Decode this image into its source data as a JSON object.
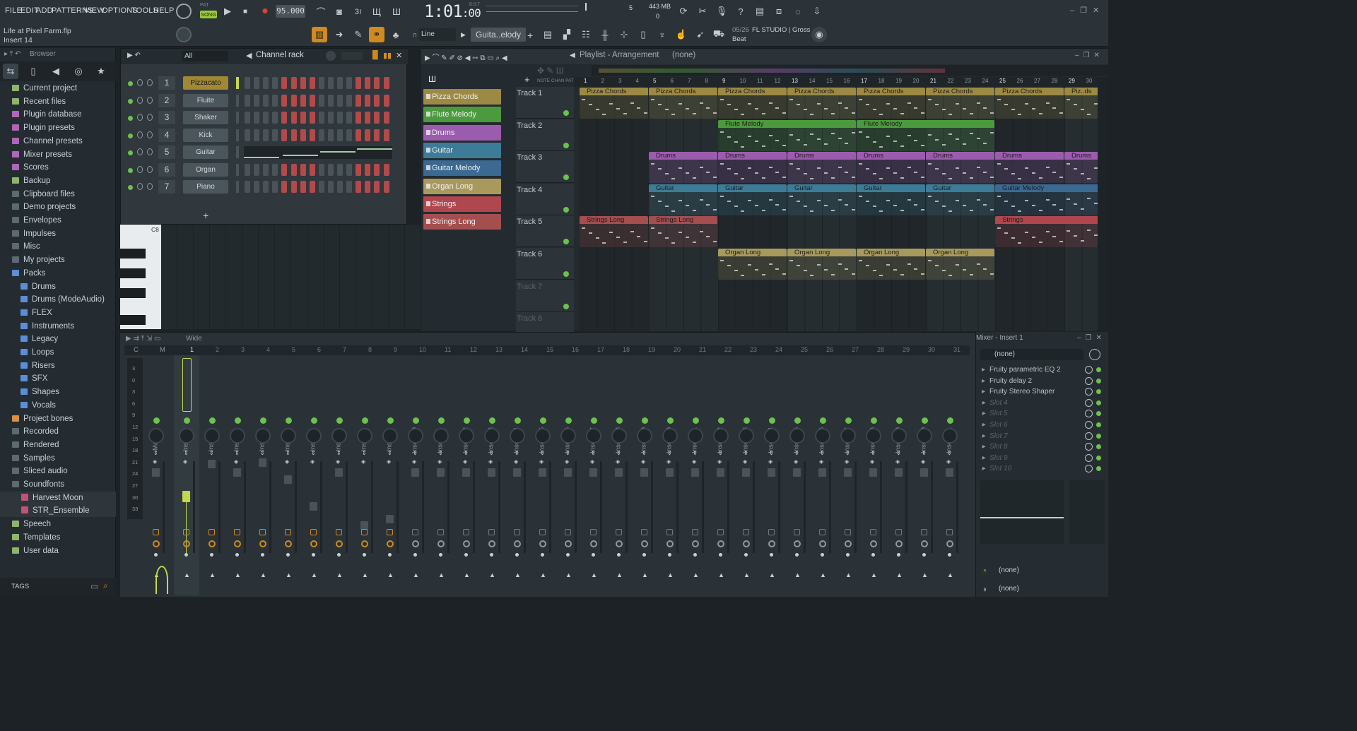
{
  "menubar": {
    "items": [
      "FILE",
      "EDIT",
      "ADD",
      "PATTERNS",
      "VIEW",
      "OPTIONS",
      "TOOLS",
      "HELP"
    ],
    "pat_label": "PAT",
    "song_label": "SONG",
    "tempo": "95.000",
    "time": "1:01",
    "time_ticks": ":00",
    "bst_label": "B:S:T",
    "cpu_value": "5",
    "memory": "443 MB",
    "poly": "0",
    "snap_mode": "Line",
    "pattern_name": "Guita..elody",
    "news_counter": "05/26",
    "news_text": "FL STUDIO | Gross",
    "news_text2": "Beat",
    "project_file": "Life at Pixel Farm.flp",
    "hint_text": "Insert 14"
  },
  "browser": {
    "title": "Browser",
    "tags_label": "TAGS",
    "items": [
      {
        "label": "Current project",
        "color": "#8fb56a"
      },
      {
        "label": "Recent files",
        "color": "#8fb56a"
      },
      {
        "label": "Plugin database",
        "color": "#b066b8"
      },
      {
        "label": "Plugin presets",
        "color": "#b066b8"
      },
      {
        "label": "Channel presets",
        "color": "#b066b8"
      },
      {
        "label": "Mixer presets",
        "color": "#b066b8"
      },
      {
        "label": "Scores",
        "color": "#b066b8"
      },
      {
        "label": "Backup",
        "color": "#8fb56a"
      },
      {
        "label": "Clipboard files",
        "color": "#5c6a72"
      },
      {
        "label": "Demo projects",
        "color": "#5c6a72"
      },
      {
        "label": "Envelopes",
        "color": "#5c6a72"
      },
      {
        "label": "Impulses",
        "color": "#5c6a72"
      },
      {
        "label": "Misc",
        "color": "#5c6a72"
      },
      {
        "label": "My projects",
        "color": "#5c6a72"
      },
      {
        "label": "Packs",
        "color": "#5a8fd8"
      },
      {
        "label": "Drums",
        "color": "#5a8fd8",
        "sub": true
      },
      {
        "label": "Drums (ModeAudio)",
        "color": "#5a8fd8",
        "sub": true
      },
      {
        "label": "FLEX",
        "color": "#5a8fd8",
        "sub": true
      },
      {
        "label": "Instruments",
        "color": "#5a8fd8",
        "sub": true
      },
      {
        "label": "Legacy",
        "color": "#5a8fd8",
        "sub": true
      },
      {
        "label": "Loops",
        "color": "#5a8fd8",
        "sub": true
      },
      {
        "label": "Risers",
        "color": "#5a8fd8",
        "sub": true
      },
      {
        "label": "SFX",
        "color": "#5a8fd8",
        "sub": true
      },
      {
        "label": "Shapes",
        "color": "#5a8fd8",
        "sub": true
      },
      {
        "label": "Vocals",
        "color": "#5a8fd8",
        "sub": true
      },
      {
        "label": "Project bones",
        "color": "#d89046"
      },
      {
        "label": "Recorded",
        "color": "#5c6a72"
      },
      {
        "label": "Rendered",
        "color": "#5c6a72"
      },
      {
        "label": "Samples",
        "color": "#5c6a72"
      },
      {
        "label": "Sliced audio",
        "color": "#5c6a72"
      },
      {
        "label": "Soundfonts",
        "color": "#5c6a72"
      },
      {
        "label": "Harvest Moon",
        "color": "#c2517a",
        "sub2": true
      },
      {
        "label": "STR_Ensemble",
        "color": "#c2517a",
        "sub2": true
      },
      {
        "label": "Speech",
        "color": "#8fb56a"
      },
      {
        "label": "Templates",
        "color": "#8fb56a"
      },
      {
        "label": "User data",
        "color": "#8fb56a"
      }
    ]
  },
  "channel_rack": {
    "title": "Channel rack",
    "filter": "All",
    "channels": [
      {
        "num": "1",
        "name": "Pizzacato",
        "selected": true
      },
      {
        "num": "2",
        "name": "Fluite"
      },
      {
        "num": "3",
        "name": "Shaker"
      },
      {
        "num": "4",
        "name": "Kick"
      },
      {
        "num": "5",
        "name": "Guitar",
        "graph": true
      },
      {
        "num": "6",
        "name": "Organ"
      },
      {
        "num": "7",
        "name": "Piano"
      }
    ],
    "add_label": "+",
    "piano_label": "C8"
  },
  "playlist": {
    "title": "Playlist - Arrangement",
    "crumb": "(none)",
    "patterns": [
      {
        "name": "Pizza Chords",
        "color": "#9c8a44"
      },
      {
        "name": "Flute Melody",
        "color": "#4c9a3e"
      },
      {
        "name": "Drums",
        "color": "#9c5cae"
      },
      {
        "name": "Guitar",
        "color": "#3d7c96"
      },
      {
        "name": "Guitar Melody",
        "color": "#3a6a92"
      },
      {
        "name": "Organ Long",
        "color": "#a79a5c"
      },
      {
        "name": "Strings",
        "color": "#b0474e"
      },
      {
        "name": "Strings Long",
        "color": "#a44e50"
      }
    ],
    "tracks": [
      "Track 1",
      "Track 2",
      "Track 3",
      "Track 4",
      "Track 5",
      "Track 6",
      "Track 7",
      "Track 8"
    ],
    "bars": [
      "1",
      "2",
      "3",
      "4",
      "5",
      "6",
      "7",
      "8",
      "9",
      "10",
      "11",
      "12",
      "13",
      "14",
      "15",
      "16",
      "17",
      "18",
      "19",
      "20",
      "21",
      "22",
      "23",
      "24",
      "25",
      "26",
      "27",
      "28",
      "29",
      "30"
    ],
    "clip_names": {
      "t1": "Pizza Chords",
      "t1_last": "Piz..ds",
      "t2": "Flute Melody",
      "t3": "Drums",
      "t4": "Guitar",
      "t4b": "Guitar Melody",
      "t5": "Strings Long",
      "t5b": "Strings",
      "t6": "Organ Long"
    }
  },
  "mixer": {
    "view": "Wide",
    "master": "Master",
    "inserts": [
      "Insert 1",
      "Insert 2",
      "Insert 3",
      "Insert 4",
      "Insert 5",
      "Insert 6",
      "Insert 7",
      "Insert 8",
      "Insert 9",
      "Insert 10",
      "Insert 11",
      "Insert 12",
      "Insert 13",
      "Insert 14",
      "Insert 15",
      "Insert 16",
      "Insert 17",
      "Insert 18",
      "Insert 19",
      "Insert 20",
      "Insert 21",
      "Insert 22",
      "Insert 23",
      "Insert 24",
      "Insert 25",
      "Insert 26",
      "Insert 27",
      "Insert 28",
      "Insert 29",
      "Insert 30",
      "Insert 31"
    ],
    "header_letters": [
      "C",
      "M"
    ],
    "scale": [
      "3",
      "0",
      "3",
      "6",
      "9",
      "12",
      "15",
      "18",
      "21",
      "24",
      "27",
      "30",
      "33"
    ],
    "fader_levels": {
      "insert1": 0.6,
      "insert2": 0.37
    }
  },
  "mixer_insert": {
    "title": "Mixer - Insert 1",
    "input": "(none)",
    "slots": [
      "Fruity parametric EQ 2",
      "Fruity delay 2",
      "Fruity Stereo Shaper",
      "Slot 4",
      "Slot 5",
      "Slot 6",
      "Slot 7",
      "Slot 8",
      "Slot 9",
      "Slot 10"
    ],
    "out1": "(none)",
    "out2": "(none)"
  }
}
